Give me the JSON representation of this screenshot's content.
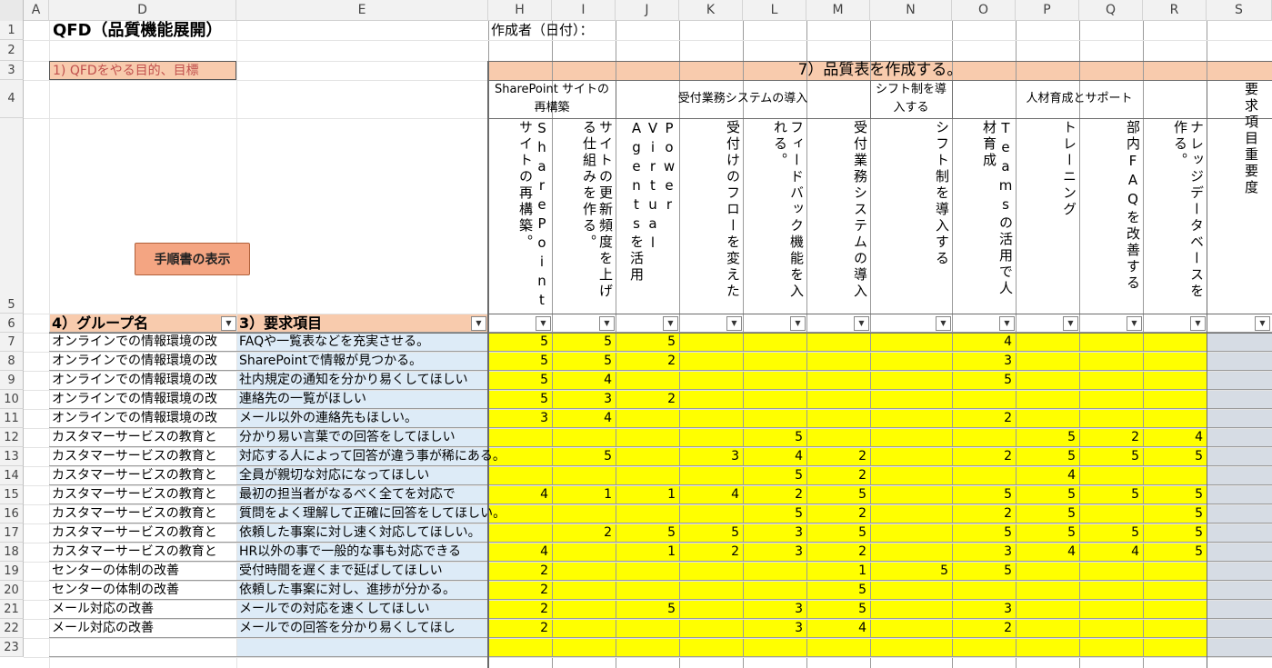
{
  "columns": [
    "A",
    "D",
    "E",
    "H",
    "I",
    "J",
    "K",
    "L",
    "M",
    "N",
    "O",
    "P",
    "Q",
    "R",
    "S"
  ],
  "rows": [
    "1",
    "2",
    "3",
    "4",
    "5",
    "6",
    "7",
    "8",
    "9",
    "10",
    "11",
    "12",
    "13",
    "14",
    "15",
    "16",
    "17",
    "18",
    "19",
    "20",
    "21",
    "22",
    "23"
  ],
  "sheet": {
    "title": "QFD（品質機能展開）",
    "author_label": "作成者（日付）：",
    "purpose_label": "1) QFDをやる目的、目標",
    "quality_table_title": "7）品質表を作成する。",
    "manual_button": "手順書の表示",
    "group_header": "4）グループ名",
    "items_header": "3）要求項目",
    "importance_header": "要求項目重要度"
  },
  "colors": {
    "header_orange": "#f8cbad",
    "yellow": "#ffff00",
    "blue_col": "#ddebf7",
    "gray_col": "#d6dce4",
    "button_fill": "#f4a582"
  },
  "categories": [
    {
      "label": "SharePoint サイトの再構築"
    },
    {
      "label": "受付業務システムの導入"
    },
    {
      "label": "シフト制を導入する"
    },
    {
      "label": "人材育成とサポート"
    }
  ],
  "measures": [
    "SharePointサイトの再構築。",
    "サイトの更新頻度を上げる仕組みを作る。",
    "Power Virtual Agentsを活用",
    "受付けのフローを変えた",
    "フィードバック機能を入れる。",
    "受付業務システムの導入",
    "シフト制を導入する",
    "Teamsの活用で人材育成",
    "トレーニング",
    "部内FAQを改善する",
    "ナレッジデータベースを作る。"
  ],
  "data_rows": [
    {
      "group": "オンラインでの情報環境の改",
      "item": "FAQや一覧表などを充実させる。",
      "v": [
        "5",
        "5",
        "5",
        "",
        "",
        "",
        "",
        "4",
        "",
        "",
        ""
      ]
    },
    {
      "group": "オンラインでの情報環境の改",
      "item": "SharePointで情報が見つかる。",
      "v": [
        "5",
        "5",
        "2",
        "",
        "",
        "",
        "",
        "3",
        "",
        "",
        ""
      ]
    },
    {
      "group": "オンラインでの情報環境の改",
      "item": "社内規定の通知を分かり易くしてほしい",
      "v": [
        "5",
        "4",
        "",
        "",
        "",
        "",
        "",
        "5",
        "",
        "",
        ""
      ]
    },
    {
      "group": "オンラインでの情報環境の改",
      "item": "連絡先の一覧がほしい",
      "v": [
        "5",
        "3",
        "2",
        "",
        "",
        "",
        "",
        "",
        "",
        "",
        ""
      ]
    },
    {
      "group": "オンラインでの情報環境の改",
      "item": "メール以外の連絡先もほしい。",
      "v": [
        "3",
        "4",
        "",
        "",
        "",
        "",
        "",
        "2",
        "",
        "",
        ""
      ]
    },
    {
      "group": "カスタマーサービスの教育と",
      "item": "分かり易い言葉での回答をしてほしい",
      "v": [
        "",
        "",
        "",
        "",
        "5",
        "",
        "",
        "",
        "5",
        "2",
        "4"
      ]
    },
    {
      "group": "カスタマーサービスの教育と",
      "item": "対応する人によって回答が違う事が稀にある。",
      "v": [
        "",
        "5",
        "",
        "3",
        "4",
        "2",
        "",
        "2",
        "5",
        "5",
        "5"
      ]
    },
    {
      "group": "カスタマーサービスの教育と",
      "item": "全員が親切な対応になってほしい",
      "v": [
        "",
        "",
        "",
        "",
        "5",
        "2",
        "",
        "",
        "4",
        "",
        ""
      ]
    },
    {
      "group": "カスタマーサービスの教育と",
      "item": "最初の担当者がなるべく全てを対応で",
      "v": [
        "4",
        "1",
        "1",
        "4",
        "2",
        "5",
        "",
        "5",
        "5",
        "5",
        "5"
      ]
    },
    {
      "group": "カスタマーサービスの教育と",
      "item": "質問をよく理解して正確に回答をしてほしい。",
      "v": [
        "",
        "",
        "",
        "",
        "5",
        "2",
        "",
        "2",
        "5",
        "",
        "5"
      ]
    },
    {
      "group": "カスタマーサービスの教育と",
      "item": "依頼した事案に対し速く対応してほしい。",
      "v": [
        "",
        "2",
        "5",
        "5",
        "3",
        "5",
        "",
        "5",
        "5",
        "5",
        "5"
      ]
    },
    {
      "group": "カスタマーサービスの教育と",
      "item": "HR以外の事で一般的な事も対応できる",
      "v": [
        "4",
        "",
        "1",
        "2",
        "3",
        "2",
        "",
        "3",
        "4",
        "4",
        "5"
      ]
    },
    {
      "group": "センターの体制の改善",
      "item": "受付時間を遅くまで延ばしてほしい",
      "v": [
        "2",
        "",
        "",
        "",
        "",
        "1",
        "5",
        "5",
        "",
        "",
        ""
      ]
    },
    {
      "group": "センターの体制の改善",
      "item": "依頼した事案に対し、進捗が分かる。",
      "v": [
        "2",
        "",
        "",
        "",
        "",
        "5",
        "",
        "",
        "",
        "",
        ""
      ]
    },
    {
      "group": "メール対応の改善",
      "item": "メールでの対応を速くしてほしい",
      "v": [
        "2",
        "",
        "5",
        "",
        "3",
        "5",
        "",
        "3",
        "",
        "",
        ""
      ]
    },
    {
      "group": "メール対応の改善",
      "item": "メールでの回答を分かり易くしてほし",
      "v": [
        "2",
        "",
        "",
        "",
        "3",
        "4",
        "",
        "2",
        "",
        "",
        ""
      ]
    },
    {
      "group": "",
      "item": "",
      "v": [
        "",
        "",
        "",
        "",
        "",
        "",
        "",
        "",
        "",
        "",
        ""
      ]
    }
  ]
}
